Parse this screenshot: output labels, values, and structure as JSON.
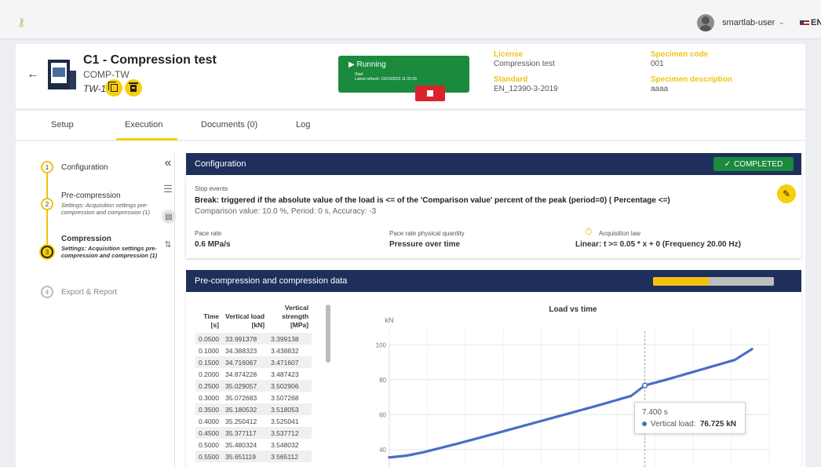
{
  "topbar": {
    "username": "smartlab-user",
    "language": "EN"
  },
  "test": {
    "title": "C1 - Compression test",
    "code": "COMP-TW",
    "tw": "TW-1",
    "status": "Running",
    "start_label": "Start",
    "latest_refresh": "Latest refresh: 19/10/2023 11:33:39",
    "license_label": "License",
    "license_value": "Compression test",
    "standard_label": "Standard",
    "standard_value": "EN_12390-3-2019",
    "specimen_code_label": "Specimen code",
    "specimen_code_value": "001",
    "specimen_desc_label": "Specimen description",
    "specimen_desc_value": "aaaa"
  },
  "tabs": [
    "Setup",
    "Execution",
    "Documents (0)",
    "Log"
  ],
  "steps": [
    {
      "num": "1",
      "title": "Configuration",
      "desc": ""
    },
    {
      "num": "2",
      "title": "Pre-compression",
      "desc": "Settings: Acquisition settings pre-compression and compression (1)"
    },
    {
      "num": "3",
      "title": "Compression",
      "desc": "Settings: Acquisition settings pre-compression and compression (1)"
    },
    {
      "num": "4",
      "title": "Export & Report",
      "desc": ""
    }
  ],
  "config": {
    "title": "Configuration",
    "status": "COMPLETED",
    "stop_events_label": "Stop events",
    "stop_event_text": "Break: triggered if the absolute value of the load is <= of the 'Comparison value' percent of the peak (period=0) ( Percentage <=)",
    "stop_event_detail": "Comparison value: 10.0 %, Period: 0 s, Accuracy: -3",
    "pace_rate_label": "Pace rate",
    "pace_rate_value": "0.6 MPa/s",
    "pace_qty_label": "Pace rate physical quantity",
    "pace_qty_value": "Pressure over time",
    "acq_law_label": "Acquisition law",
    "acq_law_value": "Linear: t >= 0.05 * x + 0 (Frequency 20.00 Hz)"
  },
  "data_section": {
    "title": "Pre-compression and compression data",
    "progress": 0.46,
    "colors": {
      "accent": "#f2c10e",
      "header": "#1e2f5c",
      "series": "#4a6dc4"
    }
  },
  "table": {
    "headers": [
      {
        "l1": "Time",
        "l2": "[s]"
      },
      {
        "l1": "Vertical load",
        "l2": "[kN]"
      },
      {
        "l1": "Vertical strength",
        "l2": "[MPa]"
      }
    ],
    "rows": [
      [
        "0.0500",
        "33.991378",
        "3.399138"
      ],
      [
        "0.1000",
        "34.388323",
        "3.438832"
      ],
      [
        "0.1500",
        "34.716067",
        "3.471607"
      ],
      [
        "0.2000",
        "34.874228",
        "3.487423"
      ],
      [
        "0.2500",
        "35.029057",
        "3.502906"
      ],
      [
        "0.3000",
        "35.072683",
        "3.507268"
      ],
      [
        "0.3500",
        "35.180532",
        "3.518053"
      ],
      [
        "0.4000",
        "35.250412",
        "3.525041"
      ],
      [
        "0.4500",
        "35.377117",
        "3.537712"
      ],
      [
        "0.5000",
        "35.480324",
        "3.548032"
      ],
      [
        "0.5500",
        "35.651119",
        "3.565112"
      ]
    ]
  },
  "chart_data": {
    "type": "line",
    "title": "Load vs time",
    "ylabel": "kN",
    "xlabel": "",
    "yticks": [
      40,
      60,
      80,
      100
    ],
    "ylim": [
      30,
      110
    ],
    "xlim": [
      0,
      11
    ],
    "series": [
      {
        "name": "Vertical load",
        "x": [
          0,
          0.5,
          1,
          2,
          3,
          4,
          5,
          6,
          7,
          7.4,
          8,
          9,
          10,
          10.5
        ],
        "y": [
          35.5,
          36.5,
          38.5,
          43.5,
          48.8,
          54.2,
          59.6,
          65.0,
          70.7,
          76.7,
          79.9,
          85.6,
          91.3,
          97.5
        ]
      }
    ],
    "tooltip": {
      "x_label": "7.400 s",
      "series": "Vertical load:",
      "value": "76.725 kN"
    }
  }
}
